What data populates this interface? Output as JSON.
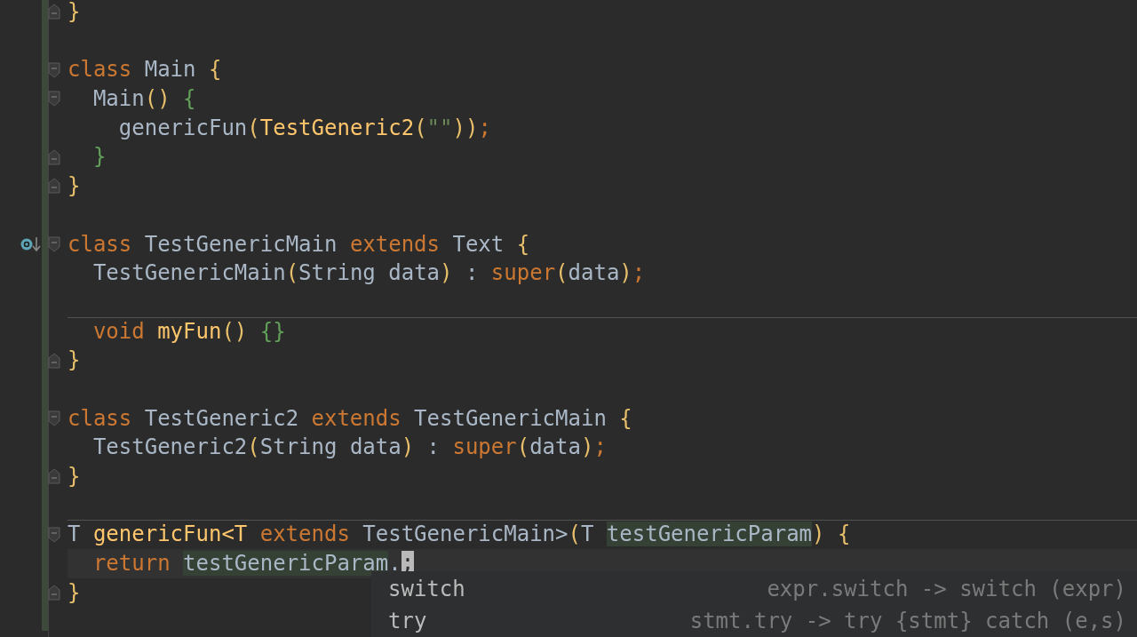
{
  "editor": {
    "lines": [
      {
        "kind": "code",
        "fold_close": true,
        "tokens": [
          {
            "t": "}",
            "kind": "brace"
          }
        ]
      },
      {
        "kind": "blank"
      },
      {
        "kind": "code",
        "fold_open": true,
        "tokens": [
          {
            "t": "class",
            "kind": "kw"
          },
          {
            "t": "Main",
            "kind": "id",
            "spaced": true
          },
          {
            "t": "{",
            "kind": "brace",
            "spaced": true
          }
        ],
        "children": [
          {
            "kind": "code",
            "fold_open": true,
            "tokens": [
              {
                "t": "Main",
                "kind": "id"
              },
              {
                "t": "()",
                "kind": "brace"
              },
              {
                "t": "{",
                "kind": "green",
                "spaced": true
              }
            ],
            "children": [
              {
                "kind": "code",
                "tokens": [
                  {
                    "t": "genericFun",
                    "kind": "id"
                  },
                  {
                    "t": "(",
                    "kind": "brace"
                  },
                  {
                    "t": "TestGeneric2",
                    "kind": "fn"
                  },
                  {
                    "t": "(",
                    "kind": "brace"
                  },
                  {
                    "t": "\"\"",
                    "kind": "str"
                  },
                  {
                    "t": "))",
                    "kind": "brace"
                  },
                  {
                    "t": ";",
                    "kind": "kw"
                  }
                ]
              }
            ]
          },
          {
            "kind": "code",
            "fold_close": true,
            "tokens": [
              {
                "t": "}",
                "kind": "green"
              }
            ]
          }
        ]
      },
      {
        "kind": "code",
        "fold_close": true,
        "tokens": [
          {
            "t": "}",
            "kind": "brace"
          }
        ]
      },
      {
        "kind": "blank"
      },
      {
        "kind": "code",
        "fold_open": true,
        "marker": true,
        "tokens": [
          {
            "t": "class",
            "kind": "kw"
          },
          {
            "t": "TestGenericMain",
            "kind": "id",
            "spaced": true
          },
          {
            "t": "extends",
            "kind": "kw",
            "spaced": true
          },
          {
            "t": "Text",
            "kind": "id",
            "spaced": true
          },
          {
            "t": "{",
            "kind": "brace",
            "spaced": true
          }
        ],
        "children": [
          {
            "kind": "code",
            "tokens": [
              {
                "t": "TestGenericMain",
                "kind": "id"
              },
              {
                "t": "(",
                "kind": "brace"
              },
              {
                "t": "String data",
                "kind": "id"
              },
              {
                "t": ")",
                "kind": "brace"
              },
              {
                "t": ":",
                "kind": "id",
                "spaced": true
              },
              {
                "t": "super",
                "kind": "kw",
                "spaced": true
              },
              {
                "t": "(",
                "kind": "brace"
              },
              {
                "t": "data",
                "kind": "id"
              },
              {
                "t": ")",
                "kind": "brace"
              },
              {
                "t": ";",
                "kind": "kw"
              }
            ]
          },
          {
            "kind": "blank"
          },
          {
            "kind": "code",
            "separator": true,
            "tokens": [
              {
                "t": "void",
                "kind": "kw"
              },
              {
                "t": "myFun",
                "kind": "fn",
                "spaced": true
              },
              {
                "t": "()",
                "kind": "brace"
              },
              {
                "t": "{}",
                "kind": "green",
                "spaced": true
              }
            ]
          }
        ]
      },
      {
        "kind": "code",
        "fold_close": true,
        "tokens": [
          {
            "t": "}",
            "kind": "brace"
          }
        ]
      },
      {
        "kind": "blank"
      },
      {
        "kind": "code",
        "fold_open": true,
        "tokens": [
          {
            "t": "class",
            "kind": "kw"
          },
          {
            "t": "TestGeneric2",
            "kind": "id",
            "spaced": true
          },
          {
            "t": "extends",
            "kind": "kw",
            "spaced": true
          },
          {
            "t": "TestGenericMain",
            "kind": "id",
            "spaced": true
          },
          {
            "t": "{",
            "kind": "brace",
            "spaced": true
          }
        ],
        "children": [
          {
            "kind": "code",
            "tokens": [
              {
                "t": "TestGeneric2",
                "kind": "id"
              },
              {
                "t": "(",
                "kind": "brace"
              },
              {
                "t": "String data",
                "kind": "id"
              },
              {
                "t": ")",
                "kind": "brace"
              },
              {
                "t": ":",
                "kind": "id",
                "spaced": true
              },
              {
                "t": "super",
                "kind": "kw",
                "spaced": true
              },
              {
                "t": "(",
                "kind": "brace"
              },
              {
                "t": "data",
                "kind": "id"
              },
              {
                "t": ")",
                "kind": "brace"
              },
              {
                "t": ";",
                "kind": "kw"
              }
            ]
          }
        ]
      },
      {
        "kind": "code",
        "fold_close": true,
        "tokens": [
          {
            "t": "}",
            "kind": "brace"
          }
        ]
      },
      {
        "kind": "blank"
      },
      {
        "kind": "code",
        "fold_open": true,
        "separator": true,
        "tokens": [
          {
            "t": "T",
            "kind": "id"
          },
          {
            "t": "genericFun<T",
            "kind": "fn",
            "spaced": true
          },
          {
            "t": "extends",
            "kind": "kw",
            "spaced": true
          },
          {
            "t": "TestGenericMain>",
            "kind": "id",
            "spaced": true
          },
          {
            "t": "(",
            "kind": "brace"
          },
          {
            "t": "T",
            "kind": "id"
          },
          {
            "t": "testGenericParam",
            "kind": "id",
            "spaced": true,
            "highlighted": true
          },
          {
            "t": ")",
            "kind": "brace"
          },
          {
            "t": "{",
            "kind": "brace",
            "spaced": true
          }
        ],
        "children": [
          {
            "kind": "code",
            "current": true,
            "tokens": [
              {
                "t": "return",
                "kind": "kw"
              },
              {
                "t": "testGenericParam",
                "kind": "id",
                "spaced": true,
                "highlighted": true
              },
              {
                "t": ".",
                "kind": "id"
              },
              {
                "t": ";",
                "kind": "kw",
                "cursor": true
              }
            ]
          }
        ]
      },
      {
        "kind": "code",
        "fold_close": true,
        "tokens": [
          {
            "t": "}",
            "kind": "brace"
          }
        ]
      },
      {
        "kind": "blank"
      }
    ]
  },
  "completion": {
    "items": [
      {
        "name": "switch",
        "hint": "expr.switch -> switch (expr)",
        "selected": false
      },
      {
        "name": "try",
        "hint": "stmt.try -> try {stmt} catch (e,s)",
        "selected": false
      }
    ]
  }
}
